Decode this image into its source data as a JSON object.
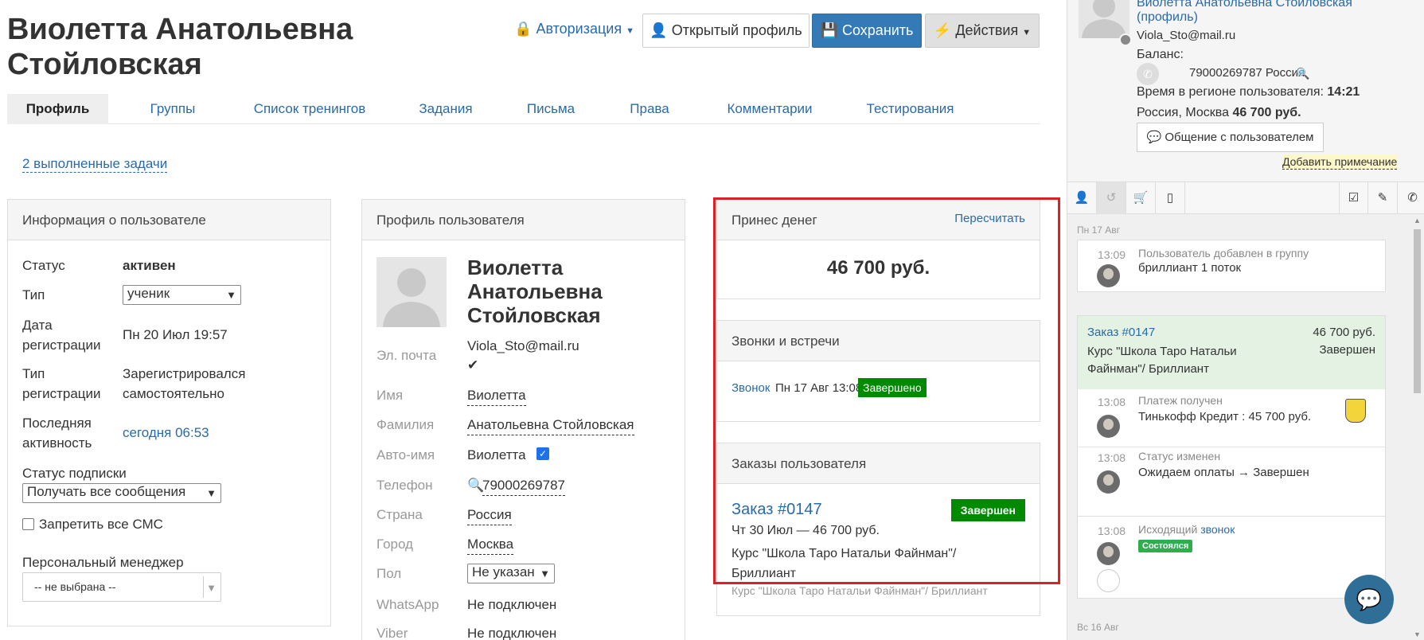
{
  "header": {
    "title_line1": "Виолетта Анатольевна",
    "title_line2": "Стойловская",
    "auth_label": "Авторизация",
    "open_profile_label": "Открытый профиль",
    "save_label": "Сохранить",
    "actions_label": "Действия"
  },
  "tabs": [
    {
      "label": "Профиль"
    },
    {
      "label": "Группы"
    },
    {
      "label": "Список тренингов"
    },
    {
      "label": "Задания"
    },
    {
      "label": "Письма"
    },
    {
      "label": "Права"
    },
    {
      "label": "Комментарии"
    },
    {
      "label": "Тестирования"
    }
  ],
  "tasks_link": "2 выполненные задачи",
  "user_info": {
    "title": "Информация о пользователе",
    "status_label": "Статус",
    "status_value": "активен",
    "type_label": "Тип",
    "type_value": "ученик",
    "reg_date_label_1": "Дата",
    "reg_date_label_2": "регистрации",
    "reg_date_value": "Пн 20 Июл 19:57",
    "reg_type_label_1": "Тип",
    "reg_type_label_2": "регистрации",
    "reg_type_value_1": "Зарегистрировался",
    "reg_type_value_2": "самостоятельно",
    "last_activity_label_1": "Последняя",
    "last_activity_label_2": "активность",
    "last_activity_value": "сегодня 06:53",
    "subscription_label": "Статус подписки",
    "subscription_value": "Получать все сообщения",
    "sms_label": "Запретить все СМС",
    "manager_label": "Персональный менеджер",
    "manager_value": "-- не выбрана --"
  },
  "profile": {
    "title": "Профиль пользователя",
    "name_line1": "Виолетта",
    "name_line2": "Анатольевна",
    "name_line3": "Стойловская",
    "email_label": "Эл. почта",
    "email_value": "Viola_Sto@mail.ru",
    "first_name_label": "Имя",
    "first_name_value": "Виолетта",
    "last_name_label": "Фамилия",
    "last_name_value": "Анатольевна Стойловская",
    "auto_name_label": "Авто-имя",
    "auto_name_value": "Виолетта",
    "phone_label": "Телефон",
    "phone_value": "79000269787",
    "country_label": "Страна",
    "country_value": "Россия",
    "city_label": "Город",
    "city_value": "Москва",
    "gender_label": "Пол",
    "gender_value": "Не указан",
    "whatsapp_label": "WhatsApp",
    "whatsapp_value": "Не подключен",
    "viber_label": "Viber",
    "viber_value": "Не подключен"
  },
  "money": {
    "title": "Принес денег",
    "recalc_label": "Пересчитать",
    "amount": "46 700 руб."
  },
  "calls": {
    "title": "Звонки и встречи",
    "call_link": "Звонок",
    "call_date": "Пн 17 Авг 13:08",
    "call_status": "Завершено"
  },
  "orders": {
    "title": "Заказы пользователя",
    "order_link": "Заказ #0147",
    "order_status": "Завершен",
    "order_line": "Чт 30 Июл — 46 700 руб.",
    "order_desc_1": "Курс \"Школа Таро Натальи Файнман\"/",
    "order_desc_2": "Бриллиант",
    "order_footer": "Курс \"Школа Таро Натальи Файнман\"/ Бриллиант"
  },
  "sidebar": {
    "name_link": "Виолетта Анатольевна Стойловская",
    "profile_link": "(профиль)",
    "email": "Viola_Sto@mail.ru",
    "balance_label": "Баланс:",
    "phone": "79000269787 Россия",
    "region_time_label": "Время в регионе пользователя:",
    "region_time_value": "14:21",
    "location": "Россия, Москва",
    "location_amount": "46 700 руб.",
    "chat_button": "Общение с пользователем",
    "add_note": "Добавить примечание",
    "feed": {
      "day1": "Пн 17 Авг",
      "ev1_time": "13:09",
      "ev1_title": "Пользователь добавлен в группу",
      "ev1_body": "бриллиант 1 поток",
      "order_link": "Заказ #0147",
      "order_amount": "46 700 руб.",
      "order_desc_1": "Курс \"Школа Таро Натальи",
      "order_desc_2": "Файнман\"/ Бриллиант",
      "order_status": "Завершен",
      "ev2_time": "13:08",
      "ev2_title": "Платеж получен",
      "ev2_body": "Тинькофф Кредит : 45 700 руб.",
      "ev3_time": "13:08",
      "ev3_title": "Статус изменен",
      "ev3_body": "Ожидаем оплаты → Завершен",
      "ev4_time": "13:08",
      "ev4_title": "Исходящий",
      "ev4_link": "звонок",
      "ev4_badge": "Состоялся",
      "day2": "Вс 16 Авг"
    }
  },
  "colors": {
    "accent": "#337ab7",
    "link": "#2a6aa8",
    "success": "#008a00",
    "highlight_box": "#e02020"
  }
}
